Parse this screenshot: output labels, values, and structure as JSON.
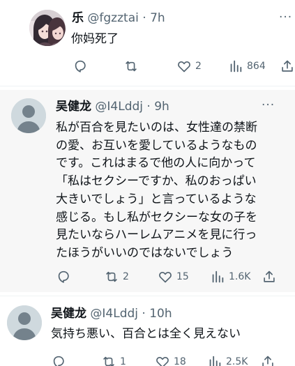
{
  "colors": {
    "text_primary": "#0f1419",
    "text_secondary": "#536471",
    "focused_background": "#f7f7f7",
    "separator": "#eff3f4",
    "default_avatar": "#cfd9de"
  },
  "tweets": [
    {
      "author_name": "乐",
      "handle": "@fgzztai",
      "separator": "·",
      "time": "7h",
      "more_label": "···",
      "text": "你妈死了",
      "avatar": "anime-avatar",
      "actions": {
        "reply_icon": "reply-icon",
        "retweet_icon": "retweet-icon",
        "like_icon": "heart-icon",
        "like_count": "2",
        "views_icon": "views-chart-icon",
        "views_count": "864",
        "share_icon": "share-icon"
      }
    },
    {
      "author_name": "吴健龙",
      "handle": "@I4Lddj",
      "separator": "·",
      "time": "9h",
      "more_label": "···",
      "text": "私が百合を見たいのは、女性達の禁断\nの愛、お互いを愛しているようなもの\nです。これはまるで他の人に向かって\n「私はセクシーですか、私のおっぱい\n大きいでしょう」と言っているような\n感じる。もし私がセクシーな女の子を\n見たいならハーレムアニメを見に行っ\nたほうがいいのではないでしょう",
      "avatar": "default-avatar",
      "actions": {
        "reply_icon": "reply-icon",
        "retweet_icon": "retweet-icon",
        "retweet_count": "2",
        "like_icon": "heart-icon",
        "like_count": "15",
        "views_icon": "views-chart-icon",
        "views_count": "1.6K",
        "share_icon": "share-icon"
      }
    },
    {
      "author_name": "吴健龙",
      "handle": "@I4Lddj",
      "separator": "·",
      "time": "10h",
      "more_label": "···",
      "text": "気持ち悪い、百合とは全く見えない",
      "avatar": "default-avatar",
      "actions": {
        "reply_icon": "reply-icon",
        "retweet_icon": "retweet-icon",
        "retweet_count": "1",
        "like_icon": "heart-icon",
        "like_count": "18",
        "views_icon": "views-chart-icon",
        "views_count": "2.5K",
        "share_icon": "share-icon"
      }
    }
  ]
}
